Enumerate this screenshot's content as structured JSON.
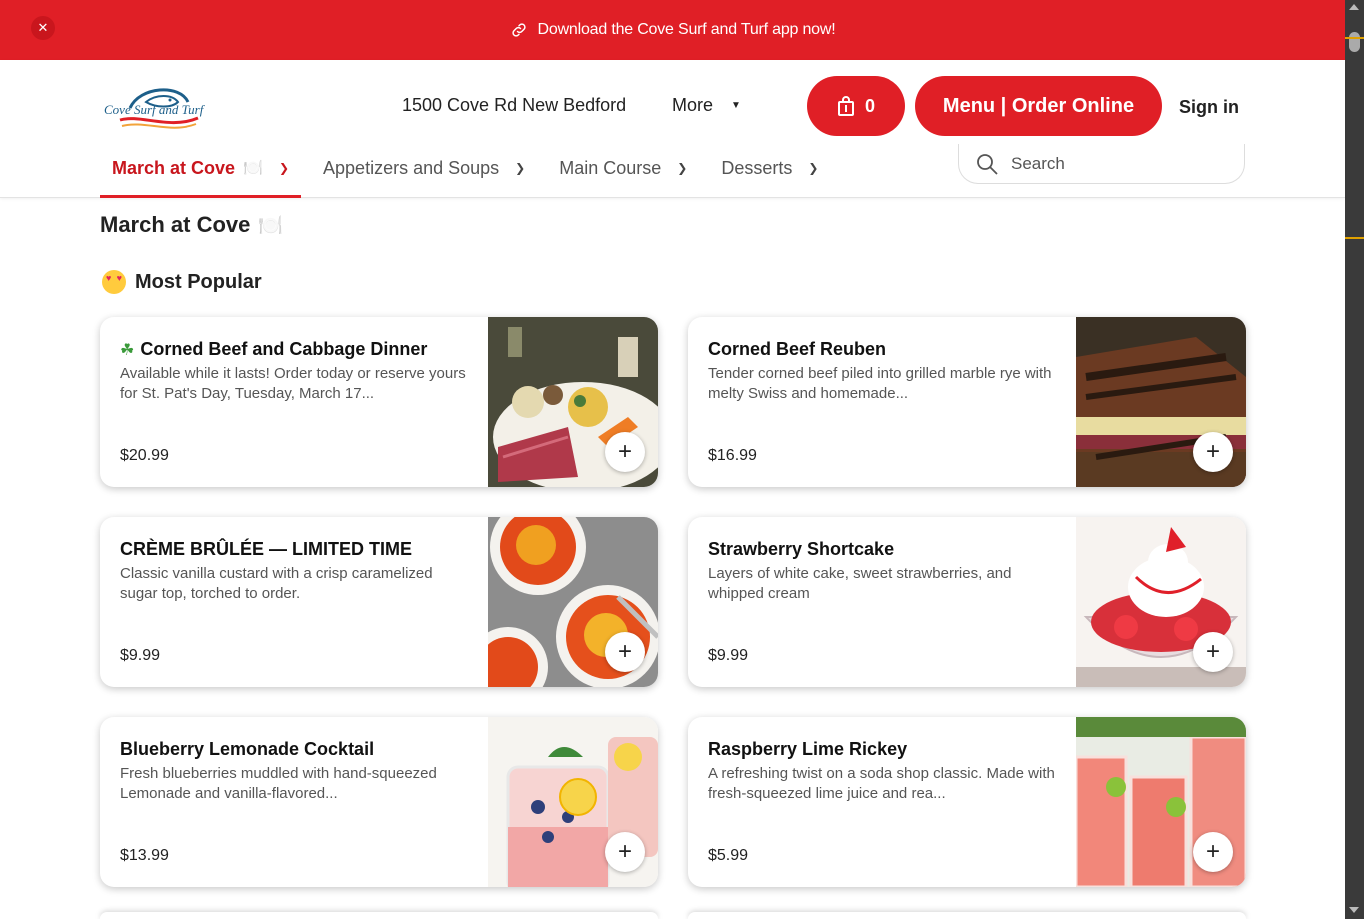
{
  "promo": {
    "text": "Download the Cove Surf and Turf app now!"
  },
  "header": {
    "logo_text": "Cove Surf and Turf",
    "address": "1500 Cove Rd New Bedford",
    "more_label": "More",
    "cart_count": "0",
    "order_label": "Menu | Order Online",
    "signin_label": "Sign in",
    "search_placeholder": "Search"
  },
  "tabs": [
    {
      "label": "March at Cove",
      "active": true
    },
    {
      "label": "Appetizers and Soups",
      "active": false
    },
    {
      "label": "Main Course",
      "active": false
    },
    {
      "label": "Desserts",
      "active": false
    }
  ],
  "main": {
    "section_title": "March at Cove",
    "subsection_title": "Most Popular",
    "items": [
      {
        "name": "Corned Beef and Cabbage Dinner",
        "description": "Available while it lasts! Order today or reserve yours for St. Pat's Day, Tuesday, March 17...",
        "price": "$20.99",
        "image": "corned-beef-cabbage-photo"
      },
      {
        "name": "Corned Beef Reuben",
        "description": "Tender corned beef piled into grilled marble rye with melty Swiss and homemade...",
        "price": "$16.99",
        "image": "reuben-sandwich-photo"
      },
      {
        "name": "CRÈME BRÛLÉE — LIMITED TIME",
        "description": "Classic vanilla custard with a crisp caramelized sugar top, torched to order.",
        "price": "$9.99",
        "image": "creme-brulee-photo"
      },
      {
        "name": "Strawberry Shortcake",
        "description": "Layers of white cake, sweet strawberries, and whipped cream",
        "price": "$9.99",
        "image": "strawberry-shortcake-photo"
      },
      {
        "name": "Blueberry Lemonade Cocktail",
        "description": "Fresh blueberries muddled with hand-squeezed Lemonade and vanilla-flavored...",
        "price": "$13.99",
        "image": "blueberry-lemonade-photo"
      },
      {
        "name": "Raspberry Lime Rickey",
        "description": "A refreshing twist on a soda shop classic. Made with fresh-squeezed lime juice and rea...",
        "price": "$5.99",
        "image": "raspberry-lime-rickey-photo"
      }
    ]
  },
  "colors": {
    "brand_red": "#e01f26",
    "active_tab": "#c8161d"
  }
}
